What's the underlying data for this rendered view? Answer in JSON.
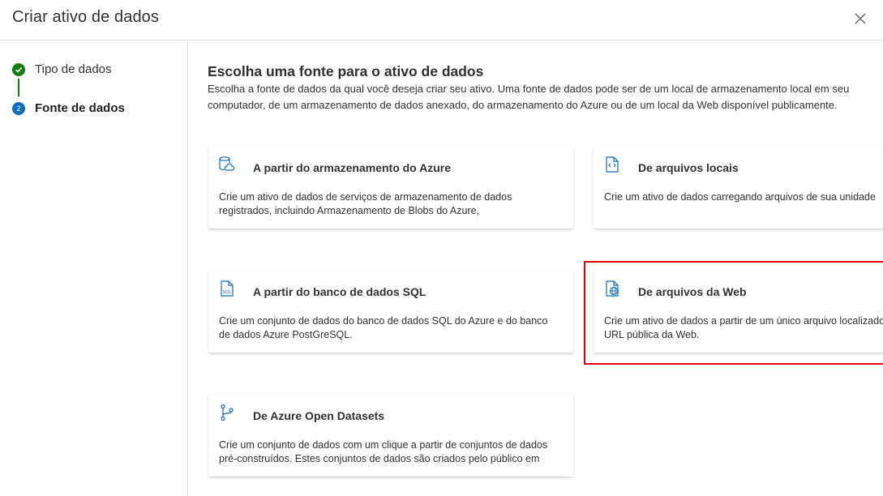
{
  "header": {
    "title": "Criar ativo de dados",
    "close_icon": "close-icon"
  },
  "steps": [
    {
      "label": "Tipo de dados",
      "state": "completed",
      "icon": "check-icon"
    },
    {
      "label": "Fonte de dados",
      "state": "current",
      "number": "2"
    }
  ],
  "main": {
    "heading": "Escolha uma fonte para o ativo de dados",
    "description": "Escolha a fonte de dados da qual você deseja criar seu ativo. Uma fonte de dados pode ser de um local de armazenamento local em seu computador, de um armazenamento de dados anexado, do armazenamento do Azure ou de um local da Web disponível publicamente.",
    "cards": [
      {
        "title": "A partir do armazenamento do Azure",
        "icon": "azure-storage-icon",
        "description_lines": [
          "Crie um ativo de dados de serviços de armazenamento de dados",
          "registrados, incluindo Armazenamento de Blobs do Azure,"
        ]
      },
      {
        "title": "De arquivos locais",
        "icon": "local-file-icon",
        "description_lines": [
          "Crie um ativo de dados carregando arquivos de sua unidade"
        ]
      },
      {
        "title": "A partir do banco de dados SQL",
        "icon": "sql-file-icon",
        "description_lines": [
          "Crie um conjunto de dados do banco de dados SQL do Azure e do banco",
          "de dados Azure PostGreSQL."
        ]
      },
      {
        "title": "De arquivos da Web",
        "icon": "web-file-icon",
        "description_lines": [
          "Crie um ativo de dados a partir de um único arquivo localizado em uma",
          "URL pública da Web."
        ],
        "highlighted": true
      },
      {
        "title": "De Azure Open Datasets",
        "icon": "open-datasets-icon",
        "description_lines": [
          "Crie um conjunto de dados com um clique a partir de conjuntos de dados",
          "pré-construídos. Estes conjuntos de dados são criados pelo público em"
        ]
      }
    ]
  },
  "colors": {
    "accent": "#0f6cbd",
    "success": "#107c10",
    "highlight": "#e00000"
  }
}
